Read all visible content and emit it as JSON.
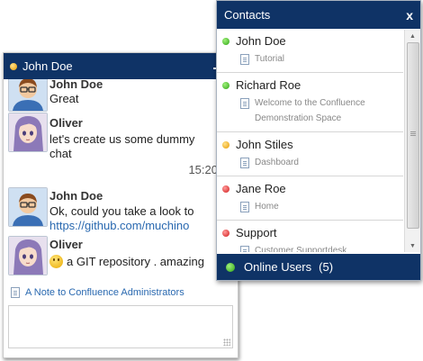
{
  "chat": {
    "title": "John Doe",
    "messages": [
      {
        "sender": "John Doe",
        "lines": [
          "Great"
        ]
      },
      {
        "sender": "Oliver",
        "lines": [
          "let's create us some dummy",
          "chat"
        ]
      },
      {
        "sender": "John Doe",
        "lines": [
          "Ok, could you take a look to",
          "https://github.com/muchino"
        ]
      },
      {
        "sender": "Oliver",
        "lines": [
          "a GIT repository . amazing"
        ]
      }
    ],
    "timestamp": "15:20",
    "note_link": "A Note to Confluence Administrators",
    "input_value": ""
  },
  "contacts": {
    "title": "Contacts",
    "close_label": "x",
    "items": [
      {
        "name": "John Doe",
        "status": "online",
        "page": "Tutorial"
      },
      {
        "name": "Richard Roe",
        "status": "online",
        "page": "Welcome to the Confluence Demonstration Space"
      },
      {
        "name": "John Stiles",
        "status": "away",
        "page": "Dashboard"
      },
      {
        "name": "Jane Roe",
        "status": "busy",
        "page": "Home"
      },
      {
        "name": "Support",
        "status": "busy",
        "page": "Customer Supportdesk"
      }
    ],
    "footer_label": "Online Users",
    "footer_count": "(5)"
  },
  "colors": {
    "header_bg": "#0f3366",
    "link": "#2a69b0",
    "online": "#2ea515",
    "away": "#e89a00",
    "busy": "#d11b1b"
  }
}
